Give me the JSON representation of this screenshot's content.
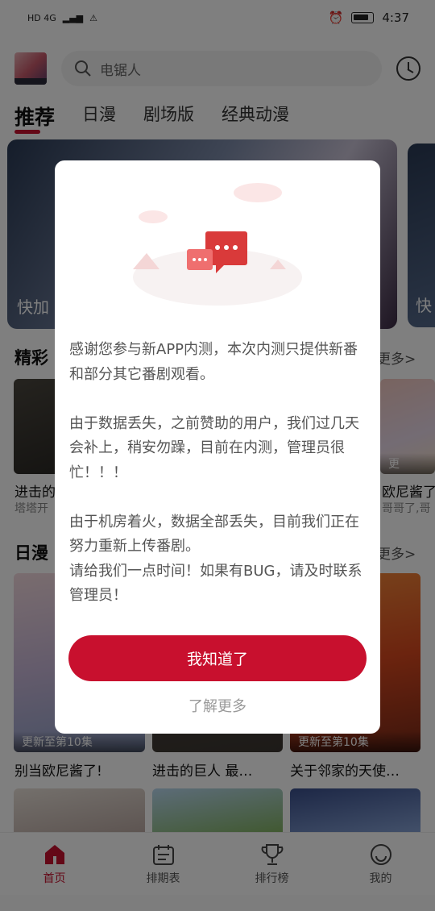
{
  "status_bar": {
    "left": "HD 4G",
    "time": "4:37"
  },
  "header": {
    "search_placeholder": "电锯人"
  },
  "tabs": [
    {
      "label": "推荐"
    },
    {
      "label": "日漫"
    },
    {
      "label": "剧场版"
    },
    {
      "label": "经典动漫"
    }
  ],
  "banner": {
    "title": "快加",
    "title2": "快"
  },
  "section1": {
    "title": "精彩",
    "more": "更多>",
    "cards": [
      {
        "title": "进击的",
        "sub": "塔塔开"
      },
      {
        "title": "欧尼酱了",
        "sub": "哥哥了,哥",
        "badge": "更"
      }
    ]
  },
  "section2": {
    "title": "日漫",
    "more": "更多>",
    "cards": [
      {
        "badge": "更新至第10集",
        "title": "别当欧尼酱了!"
      },
      {
        "badge": "",
        "title": "进击的巨人 最…"
      },
      {
        "badge": "更新至第10集",
        "title": "关于邻家的天使…"
      }
    ]
  },
  "bottom_nav": [
    {
      "label": "首页",
      "icon": "home-icon"
    },
    {
      "label": "排期表",
      "icon": "calendar-icon"
    },
    {
      "label": "排行榜",
      "icon": "trophy-icon"
    },
    {
      "label": "我的",
      "icon": "smile-icon"
    }
  ],
  "dialog": {
    "paragraph1": "感谢您参与新APP内测，本次内测只提供新番和部分其它番剧观看。",
    "paragraph2": "由于数据丢失，之前赞助的用户，我们过几天会补上，稍安勿躁，目前在内测，管理员很忙！！！",
    "paragraph3": "由于机房着火，数据全部丢失，目前我们正在努力重新上传番剧。",
    "paragraph4": "请给我们一点时间！如果有BUG，请及时联系管理员！",
    "confirm_label": "我知道了",
    "learn_more_label": "了解更多"
  },
  "colors": {
    "accent": "#c8102e"
  }
}
